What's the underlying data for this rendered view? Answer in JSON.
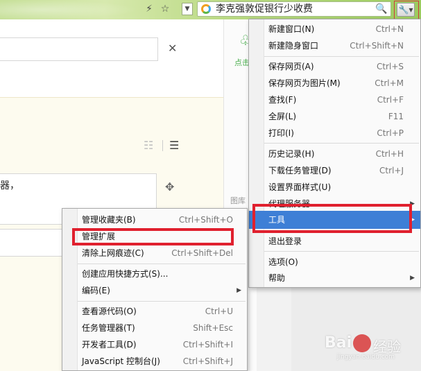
{
  "toolbar": {
    "bolt_icon": "⚡",
    "star_icon": "☆",
    "dropdown_icon": "▼",
    "address_text": "李克强敦促银行少收费",
    "search_icon": "🔍",
    "wrench_icon": "🔧▾"
  },
  "content": {
    "close_icon": "✕",
    "text_line": "器，",
    "move_icon": "✥",
    "ellipsis": "⌄",
    "list_icon_1": "☷",
    "list_icon_2": "☰"
  },
  "mid": {
    "label_1": "点击",
    "label_2": "图库"
  },
  "main_menu": {
    "items": [
      {
        "label": "新建窗口(N)",
        "shortcut": "Ctrl+N"
      },
      {
        "label": "新建隐身窗口",
        "shortcut": "Ctrl+Shift+N"
      },
      {
        "label": "保存网页(A)",
        "shortcut": "Ctrl+S"
      },
      {
        "label": "保存网页为图片(M)",
        "shortcut": "Ctrl+M"
      },
      {
        "label": "查找(F)",
        "shortcut": "Ctrl+F"
      },
      {
        "label": "全屏(L)",
        "shortcut": "F11"
      },
      {
        "label": "打印(I)",
        "shortcut": "Ctrl+P"
      },
      {
        "label": "历史记录(H)",
        "shortcut": "Ctrl+H"
      },
      {
        "label": "下载任务管理(D)",
        "shortcut": "Ctrl+J"
      },
      {
        "label": "设置界面样式(U)",
        "shortcut": ""
      },
      {
        "label": "代理服务器",
        "shortcut": ""
      },
      {
        "label": "工具",
        "shortcut": ""
      },
      {
        "label": "退出登录",
        "shortcut": ""
      },
      {
        "label": "选项(O)",
        "shortcut": ""
      },
      {
        "label": "帮助",
        "shortcut": ""
      }
    ],
    "submenu_arrow": "▶"
  },
  "sub_menu": {
    "items": [
      {
        "label": "管理收藏夹(B)",
        "shortcut": "Ctrl+Shift+O"
      },
      {
        "label": "管理扩展",
        "shortcut": ""
      },
      {
        "label": "清除上网痕迹(C)",
        "shortcut": "Ctrl+Shift+Del"
      },
      {
        "label": "创建应用快捷方式(S)...",
        "shortcut": ""
      },
      {
        "label": "编码(E)",
        "shortcut": ""
      },
      {
        "label": "查看源代码(O)",
        "shortcut": "Ctrl+U"
      },
      {
        "label": "任务管理器(T)",
        "shortcut": "Shift+Esc"
      },
      {
        "label": "开发者工具(D)",
        "shortcut": "Ctrl+Shift+I"
      },
      {
        "label": "JavaScript 控制台(J)",
        "shortcut": "Ctrl+Shift+J"
      }
    ]
  },
  "watermark": {
    "brand": "Bai",
    "brand_cn": "经验",
    "url": "jingyan.baidu.com"
  },
  "colors": {
    "highlight": "#3e7fd6",
    "annotation_red": "#e0202e"
  }
}
